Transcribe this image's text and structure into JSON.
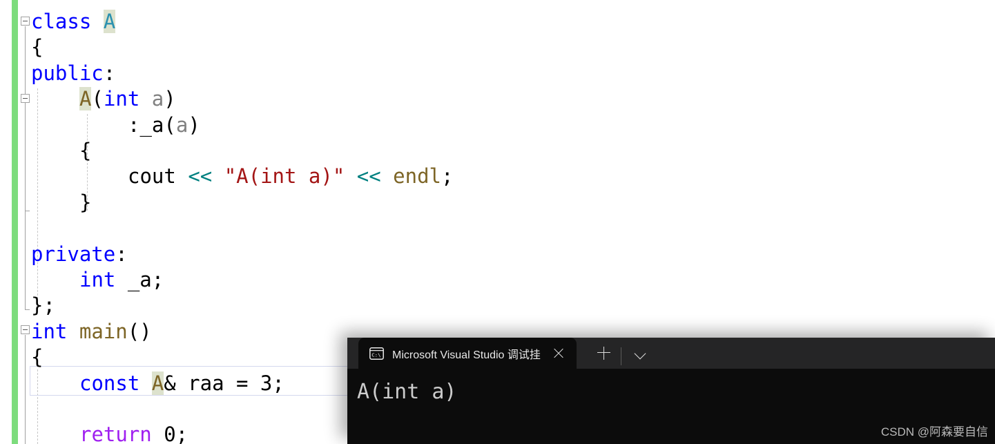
{
  "editor": {
    "language": "cpp",
    "colors": {
      "background": "#ffffff",
      "keyword": "#0000ff",
      "type": "#2b91af",
      "function": "#7d6526",
      "string": "#a31515",
      "operator": "#008080",
      "parameter": "#808080",
      "return_keyword": "#a020f0",
      "change_bar": "#7ddc7d",
      "reference_highlight": "#dde2cd",
      "current_line_border": "#d4d8ee"
    },
    "lines": [
      {
        "n": 1,
        "indent": 0,
        "collapse": "minus",
        "tokens": [
          {
            "t": "class ",
            "c": "kw"
          },
          {
            "t": "A",
            "c": "type",
            "hl": true
          }
        ]
      },
      {
        "n": 2,
        "indent": 0,
        "tokens": [
          {
            "t": "{",
            "c": "plain"
          }
        ]
      },
      {
        "n": 3,
        "indent": 0,
        "tokens": [
          {
            "t": "public",
            "c": "kw"
          },
          {
            "t": ":",
            "c": "plain"
          }
        ]
      },
      {
        "n": 4,
        "indent": 1,
        "collapse": "minus",
        "tokens": [
          {
            "t": "A",
            "c": "fn",
            "hl": true
          },
          {
            "t": "(",
            "c": "plain"
          },
          {
            "t": "int",
            "c": "kw"
          },
          {
            "t": " ",
            "c": "plain"
          },
          {
            "t": "a",
            "c": "param"
          },
          {
            "t": ")",
            "c": "plain"
          }
        ]
      },
      {
        "n": 5,
        "indent": 2,
        "tokens": [
          {
            "t": ":_a(",
            "c": "plain"
          },
          {
            "t": "a",
            "c": "param"
          },
          {
            "t": ")",
            "c": "plain"
          }
        ]
      },
      {
        "n": 6,
        "indent": 1,
        "tokens": [
          {
            "t": "{",
            "c": "plain"
          }
        ]
      },
      {
        "n": 7,
        "indent": 2,
        "tokens": [
          {
            "t": "cout ",
            "c": "plain"
          },
          {
            "t": "<<",
            "c": "op"
          },
          {
            "t": " ",
            "c": "plain"
          },
          {
            "t": "\"A(int a)\"",
            "c": "str"
          },
          {
            "t": " ",
            "c": "plain"
          },
          {
            "t": "<<",
            "c": "op"
          },
          {
            "t": " ",
            "c": "plain"
          },
          {
            "t": "endl",
            "c": "fn"
          },
          {
            "t": ";",
            "c": "plain"
          }
        ]
      },
      {
        "n": 8,
        "indent": 1,
        "tokens": [
          {
            "t": "}",
            "c": "plain"
          }
        ]
      },
      {
        "n": 9,
        "indent": 0,
        "tokens": []
      },
      {
        "n": 10,
        "indent": 0,
        "tokens": [
          {
            "t": "private",
            "c": "kw"
          },
          {
            "t": ":",
            "c": "plain"
          }
        ]
      },
      {
        "n": 11,
        "indent": 1,
        "tokens": [
          {
            "t": "int",
            "c": "kw"
          },
          {
            "t": " _a;",
            "c": "plain"
          }
        ]
      },
      {
        "n": 12,
        "indent": 0,
        "tokens": [
          {
            "t": "};",
            "c": "plain"
          }
        ]
      },
      {
        "n": 13,
        "indent": 0,
        "collapse": "minus",
        "tokens": [
          {
            "t": "int",
            "c": "kw"
          },
          {
            "t": " ",
            "c": "plain"
          },
          {
            "t": "main",
            "c": "fn"
          },
          {
            "t": "()",
            "c": "plain"
          }
        ]
      },
      {
        "n": 14,
        "indent": 0,
        "tokens": [
          {
            "t": "{",
            "c": "plain"
          }
        ]
      },
      {
        "n": 15,
        "indent": 1,
        "current": true,
        "tokens": [
          {
            "t": "const",
            "c": "kw"
          },
          {
            "t": " ",
            "c": "plain"
          },
          {
            "t": "A",
            "c": "fn",
            "hl": true
          },
          {
            "t": "& raa = 3;",
            "c": "plain"
          }
        ]
      },
      {
        "n": 16,
        "indent": 0,
        "tokens": []
      },
      {
        "n": 17,
        "indent": 1,
        "tokens": [
          {
            "t": "return",
            "c": "ret"
          },
          {
            "t": " 0;",
            "c": "plain"
          }
        ]
      }
    ]
  },
  "terminal": {
    "tab": {
      "title": "Microsoft Visual Studio 调试挂",
      "icon": "command-prompt-icon",
      "icon_label": "C:\\",
      "close_label": "×"
    },
    "new_tab_label": "+",
    "dropdown_label": "˅",
    "output": [
      "A(int a)"
    ],
    "colors": {
      "tabbar_background": "#252526",
      "body_background": "#0c0c0c",
      "text": "#cccccc"
    }
  },
  "watermark": {
    "text": "CSDN @阿森要自信"
  }
}
